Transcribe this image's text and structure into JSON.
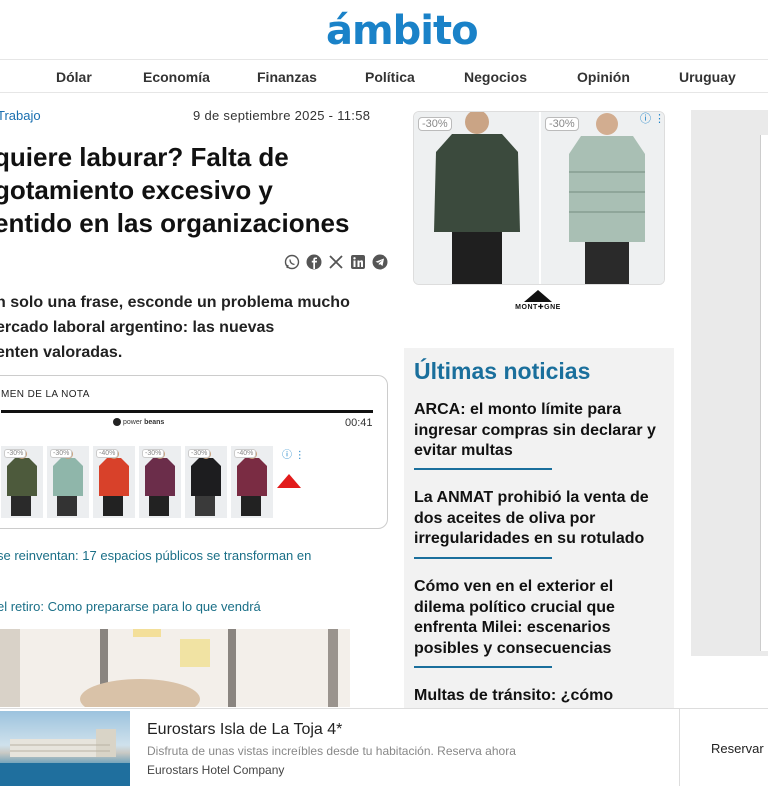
{
  "header": {
    "logo": "ámbito",
    "nav": [
      "Dólar",
      "Economía",
      "Finanzas",
      "Política",
      "Negocios",
      "Opinión",
      "Uruguay"
    ]
  },
  "article": {
    "section": "Trabajo",
    "date": "9 de septiembre 2025 - 11:58",
    "headline_lines": [
      "quiere laburar? Falta de",
      "gotamiento excesivo y",
      "entido en las organizaciones"
    ],
    "share_icons": [
      "whatsapp-icon",
      "facebook-icon",
      "x-icon",
      "linkedin-icon",
      "telegram-icon"
    ],
    "lead_lines": [
      "n solo una frase, esconde un problema mucho",
      "ercado laboral argentino: las nuevas",
      "enten valoradas."
    ],
    "audio": {
      "title": "MEN DE LA NOTA",
      "brand_prefix": "power",
      "brand_suffix": "beans",
      "time": "00:41",
      "discounts": [
        "-30%",
        "-30%",
        "-40%",
        "-30%",
        "-30%",
        "-40%"
      ],
      "info": "ⓘ ⋮"
    },
    "related": [
      "se reinventan: 17 espacios públicos se transforman en",
      "el retiro: Como prepararse para lo que vendrá"
    ]
  },
  "right_ad": {
    "discounts": [
      "-30%",
      "-30%"
    ],
    "info": "ⓘ ⋮",
    "brand": "MONT✚GNE"
  },
  "latest_news": {
    "title": "Últimas noticias",
    "items": [
      [
        "ARCA: el monto límite para",
        "ingresar compras sin declarar y",
        "evitar multas"
      ],
      [
        "La ANMAT prohibió la venta de",
        "dos aceites de oliva por",
        "irregularidades en su rotulado"
      ],
      [
        "Cómo ven en el exterior el",
        "dilema político crucial que",
        "enfrenta Milei: escenarios",
        "posibles y consecuencias"
      ],
      [
        "Multas de tránsito: ¿cómo"
      ]
    ]
  },
  "bottom_ad": {
    "title": "Eurostars Isla de La Toja 4*",
    "description": "Disfruta de unas vistas increíbles desde tu habitación. Reserva ahora",
    "brand": "Eurostars Hotel Company",
    "button": "Reservar"
  },
  "colors": {
    "brand_blue": "#1a82c8",
    "headline_blue": "#1a6f9c",
    "link_teal": "#1a6f87"
  }
}
